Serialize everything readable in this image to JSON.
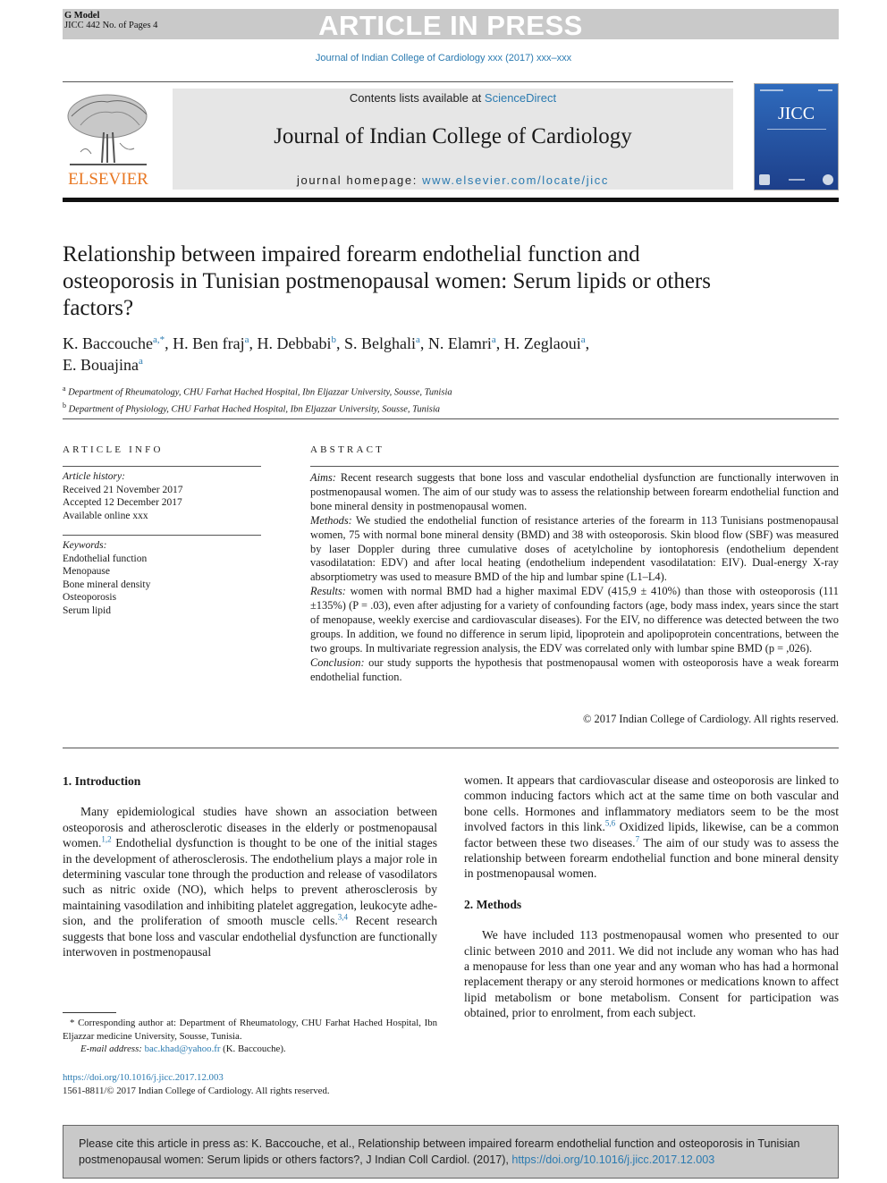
{
  "banner": {
    "model_label": "G Model",
    "pages_label": "JICC 442 No. of Pages 4",
    "status": "ARTICLE IN PRESS"
  },
  "journal_ref": "Journal of Indian College of Cardiology xxx (2017) xxx–xxx",
  "masthead": {
    "publisher_logo_icon": "elsevier-tree-icon",
    "publisher_name": "ELSEVIER",
    "contents_prefix": "Contents lists available at ",
    "contents_link": "ScienceDirect",
    "journal_name": "Journal of Indian College of Cardiology",
    "homepage_prefix": "journal homepage: ",
    "homepage_link": "www.elsevier.com/locate/jicc",
    "cover_title": "JICC",
    "colors": {
      "publisher_orange": "#e87722",
      "link_blue": "#2a7ab0",
      "cover_blue": "#2f6bbd"
    }
  },
  "article": {
    "title": "Relationship between impaired forearm endothelial function and osteoporosis in Tunisian postmenopausal women: Serum lipids or others factors?",
    "authors": [
      {
        "name": "K. Baccouche",
        "sup": "a,*"
      },
      {
        "name": "H. Ben fraj",
        "sup": "a"
      },
      {
        "name": "H. Debbabi",
        "sup": "b"
      },
      {
        "name": "S. Belghali",
        "sup": "a"
      },
      {
        "name": "N. Elamri",
        "sup": "a"
      },
      {
        "name": "H. Zeglaoui",
        "sup": "a"
      },
      {
        "name": "E. Bouajina",
        "sup": "a"
      }
    ],
    "affiliations": [
      {
        "key": "a",
        "text": "Department of Rheumatology, CHU Farhat Hached Hospital, Ibn Eljazzar University, Sousse, Tunisia"
      },
      {
        "key": "b",
        "text": "Department of Physiology, CHU Farhat Hached Hospital, Ibn Eljazzar University, Sousse, Tunisia"
      }
    ]
  },
  "article_info": {
    "heading": "ARTICLE INFO",
    "history_label": "Article history:",
    "history": [
      "Received 21 November 2017",
      "Accepted 12 December 2017",
      "Available online xxx"
    ],
    "keywords_label": "Keywords:",
    "keywords": [
      "Endothelial function",
      "Menopause",
      "Bone mineral density",
      "Osteoporosis",
      "Serum lipid"
    ]
  },
  "abstract": {
    "heading": "ABSTRACT",
    "sections": [
      {
        "label": "Aims:",
        "text": " Recent research suggests that bone loss and vascular endothelial dysfunction are functionally interwoven in postmenopausal women. The aim of our study was to assess the relationship between forearm endothelial function and bone mineral density in postmenopausal women."
      },
      {
        "label": "Methods:",
        "text": " We studied the endothelial function of resistance arteries of the forearm in 113 Tunisians postmenopausal women, 75 with normal bone mineral density (BMD) and 38 with osteoporosis. Skin blood flow (SBF) was measured by laser Doppler during three cumulative doses of acetylcholine by iontophoresis (endothelium dependent vasodilatation: EDV) and after local heating (endothelium independent vasodilatation: EIV). Dual-energy X-ray absorptiometry was used to measure BMD of the hip and lumbar spine (L1–L4)."
      },
      {
        "label": "Results:",
        "text": " women with normal BMD had a higher maximal EDV (415,9 ± 410%) than those with osteoporosis (111 ±135%) (P = .03), even after adjusting for a variety of confounding factors (age, body mass index, years since the start of menopause, weekly exercise and cardiovascular diseases). For the EIV, no difference was detected between the two groups. In addition, we found no difference in serum lipid, lipoprotein and apolipoprotein concentrations, between the two groups. In multivariate regression analysis, the EDV was correlated only with lumbar spine BMD (p = ,026)."
      },
      {
        "label": "Conclusion:",
        "text": " our study supports the hypothesis that postmenopausal women with osteoporosis have a weak forearm endothelial function."
      }
    ],
    "copyright": "© 2017 Indian College of Cardiology. All rights reserved."
  },
  "body": {
    "intro_heading": "1. Introduction",
    "intro_parts": [
      "Many epidemiological studies have shown an association between osteoporosis and atherosclerotic diseases in the elderly or postmenopausal women.",
      "1,2",
      " Endothelial dysfunction is thought to be one of the initial stages in the development of atherosclerosis. The endothelium plays a major role in determining vascular tone through the production and release of vasodilators such as nitric oxide (NO), which helps to prevent atherosclerosis by maintaining vasodilation and inhibiting platelet aggregation, leukocyte adhe-sion, and the proliferation of smooth muscle cells.",
      "3,4",
      " Recent research suggests that bone loss and vascular endothelial dysfunction are functionally interwoven in postmenopausal women. It appears that cardiovascular disease and osteoporosis are linked to common inducing factors which act at the same time on both vascular and bone cells. Hormones and inflammatory mediators seem to be the most involved factors in this link.",
      "5,6",
      " Oxidized lipids, likewise, can be a common factor between these two diseases.",
      "7",
      " The aim of our study was to assess the relationship between forearm endothelial function and bone mineral density in postmenopausal women."
    ],
    "methods_heading": "2. Methods",
    "methods_text": "We have included 113 postmenopausal women who presented to our clinic between 2010 and 2011. We did not include any woman who has had a menopause for less than one year and any woman who has had a hormonal replacement therapy or any steroid hormones or medications known to affect lipid metabolism or bone metabolism. Consent for participation was obtained, prior to enrolment, from each subject."
  },
  "footnotes": {
    "corresponding": "* Corresponding author at: Department of Rheumatology, CHU Farhat Hached Hospital, Ibn Eljazzar medicine University, Sousse, Tunisia.",
    "email_label": "E-mail address:",
    "email": "bac.khad@yahoo.fr",
    "email_owner": " (K.  Baccouche).",
    "doi": "https://doi.org/10.1016/j.jicc.2017.12.003",
    "issn": "1561-8811/© 2017 Indian College of Cardiology. All rights reserved."
  },
  "citation_box": {
    "text": "Please cite this article in press as: K. Baccouche, et al., Relationship between impaired forearm endothelial function and osteoporosis in Tunisian postmenopausal women: Serum lipids or others factors?, J Indian Coll Cardiol. (2017), ",
    "doi_link": "https://doi.org/10.1016/j.jicc.2017.12.003"
  }
}
